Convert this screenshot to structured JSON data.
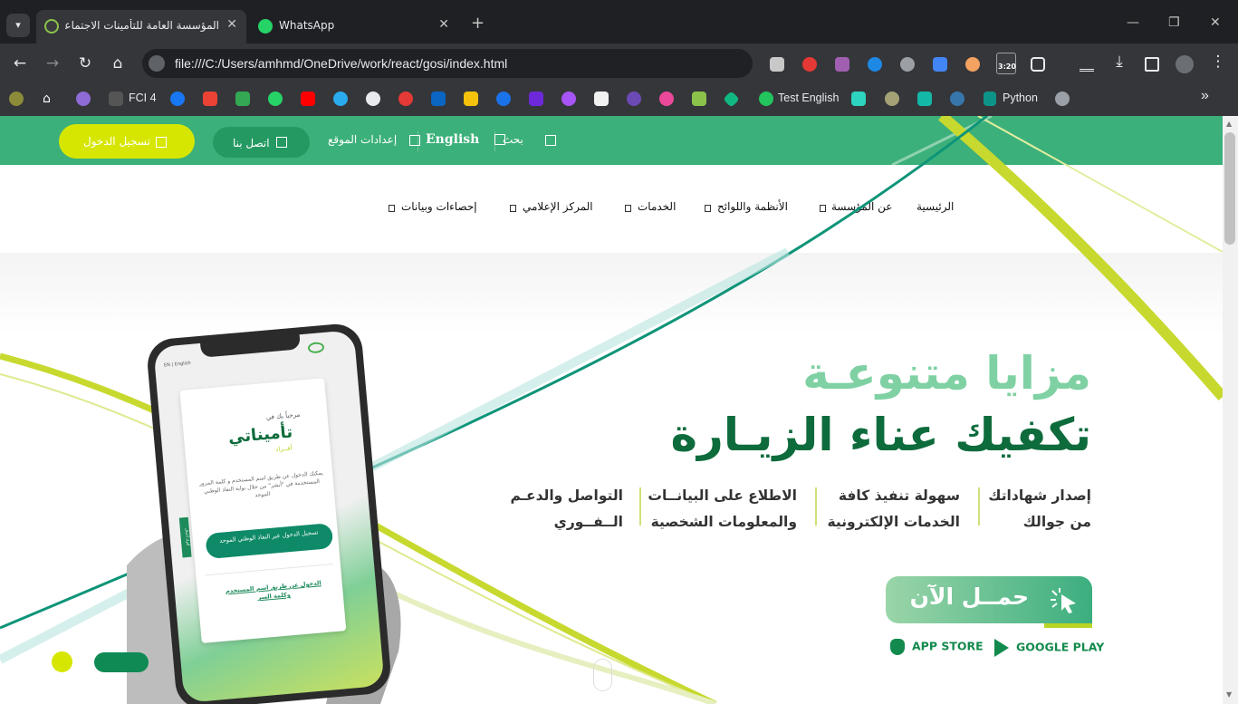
{
  "browser": {
    "tabs": [
      {
        "title": "المؤسسة العامة للتأمينات الاجتماعية",
        "active": true
      },
      {
        "title": "WhatsApp",
        "active": false
      }
    ],
    "address": "file:///C:/Users/amhmd/OneDrive/work/react/gosi/index.html",
    "clock_badge": "3:20",
    "bookmarks": {
      "fci": "FCI 4",
      "test_english": "Test English",
      "python": "Python"
    },
    "more_bookmarks": "»"
  },
  "site": {
    "topbar": {
      "search": "بحث",
      "english": "English",
      "settings": "إعدادات الموقع",
      "contact": "اتصل بنا",
      "login": "تسجيل الدخول"
    },
    "nav": [
      "الرئيسية",
      "عن المؤسسة",
      "الأنظمة واللوائح",
      "الخدمات",
      "المركز الإعلامي",
      "إحصاءات وبيانات"
    ],
    "hero": {
      "title1": "مزايا متنوعـة",
      "title2": "تكفيك عناء الزيـارة",
      "features": [
        [
          "إصدار شهاداتك",
          "من جوالك"
        ],
        [
          "سهولة تنفيذ كافة",
          "الخدمات الإلكترونية"
        ],
        [
          "الاطلاع على البيانــات",
          "والمعلومات الشخصية"
        ],
        [
          "التواصل والدعـم",
          "الــفــوري"
        ]
      ],
      "download": "حمــل الآن",
      "app_store": "APP STORE",
      "google_play": "GOOGLE PLAY"
    },
    "phone": {
      "lang": "EN | English",
      "welcome": "مرحباً بك في",
      "brand": "تأميناتي",
      "brand_sub": "أفــراد",
      "desc": "يمكنك الدخول عن طريق اسم المستخدم و كلمة المرور المستخدمة في \"أبشر\" من خلال بوابة النفاذ الوطني الموحد",
      "nafath_btn": "تسجيل الدخول عبر النفاذ الوطني الموحد",
      "user_link": "الدخول عن طريق اسم المستخدم وكلمة السر",
      "side_tab": "أفراد أعمال"
    }
  },
  "colors": {
    "primary": "#3cb07a",
    "accent": "#d6e600",
    "dark": "#0e6b3c"
  }
}
